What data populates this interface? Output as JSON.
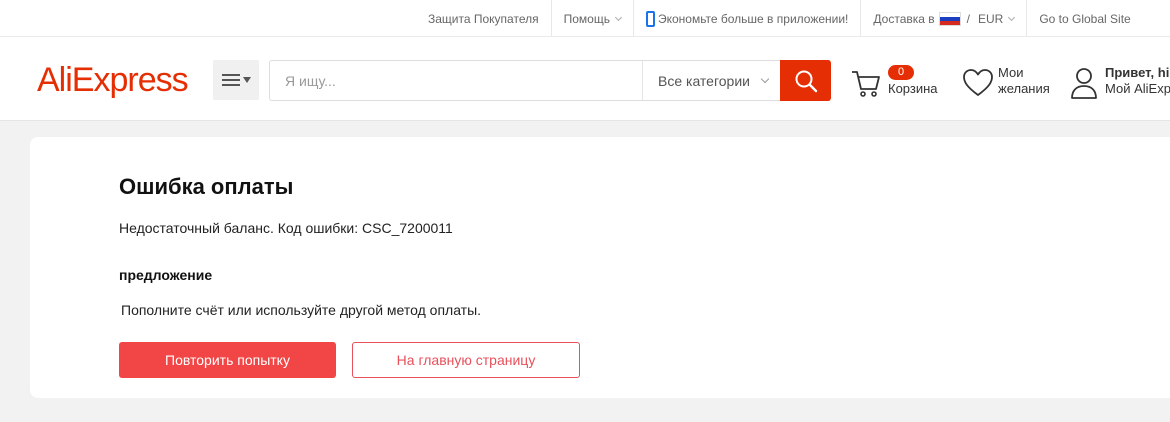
{
  "topbar": {
    "buyer_protection": "Защита Покупателя",
    "help": "Помощь",
    "app_promo": "Экономьте больше в приложении!",
    "shipping_to": "Доставка в",
    "currency_sep": "/",
    "currency": "EUR",
    "global_site": "Go to Global Site"
  },
  "header": {
    "logo": "AliExpress",
    "search_placeholder": "Я ищу...",
    "category": "Все категории",
    "cart_count": "0",
    "cart_label": "Корзина",
    "wishlist_line1": "Мои",
    "wishlist_line2": "желания",
    "account_greeting": "Привет, hi",
    "account_name": "Мой AliExpress"
  },
  "error": {
    "title": "Ошибка оплаты",
    "message": "Недостаточный баланс. Код ошибки: CSC_7200011",
    "suggestion_title": "предложение",
    "suggestion_text": "Пополните счёт или используйте другой метод оплаты.",
    "retry_button": "Повторить попытку",
    "home_button": "На главную страницу"
  },
  "colors": {
    "brand": "#e62e04",
    "retry_button": "#f24646",
    "home_button_border": "#e8505b"
  },
  "icons": [
    "menu-icon",
    "search-icon",
    "cart-icon",
    "heart-icon",
    "user-icon",
    "phone-icon",
    "russia-flag-icon"
  ]
}
